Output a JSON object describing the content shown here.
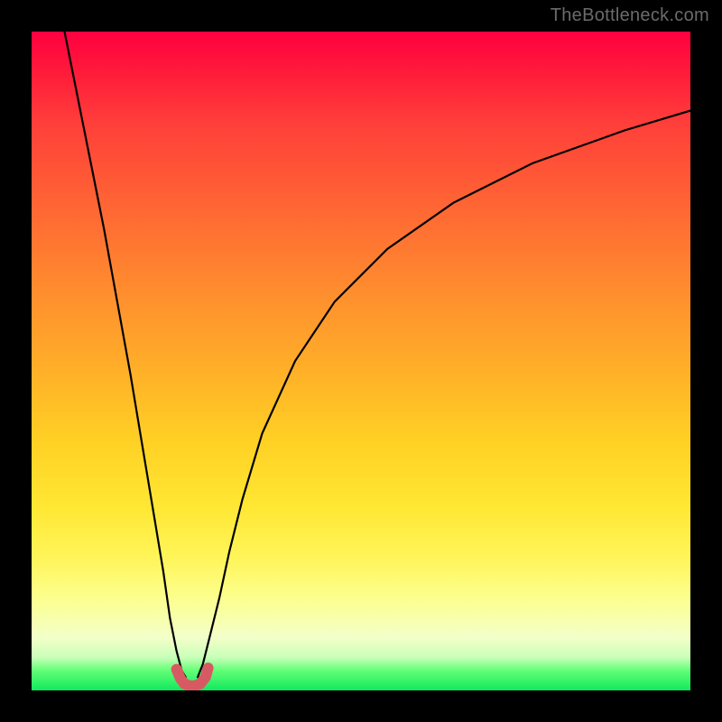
{
  "watermark": "TheBottleneck.com",
  "chart_data": {
    "type": "line",
    "title": "",
    "xlabel": "",
    "ylabel": "",
    "xlim": [
      0,
      100
    ],
    "ylim": [
      0,
      100
    ],
    "grid": false,
    "legend": false,
    "series": [
      {
        "name": "left-branch",
        "x": [
          5,
          7,
          9,
          11,
          13,
          15,
          17,
          18.5,
          20,
          21,
          22,
          22.8,
          23.4
        ],
        "y": [
          100,
          90,
          80,
          70,
          59,
          48,
          36,
          27,
          18,
          11,
          6,
          3,
          2
        ]
      },
      {
        "name": "right-branch",
        "x": [
          25.2,
          26,
          27,
          28.5,
          30,
          32,
          35,
          40,
          46,
          54,
          64,
          76,
          90,
          100
        ],
        "y": [
          2,
          4,
          8,
          14,
          21,
          29,
          39,
          50,
          59,
          67,
          74,
          80,
          85,
          88
        ]
      },
      {
        "name": "valley-marker",
        "x": [
          22.0,
          22.6,
          23.2,
          24.0,
          24.8,
          25.6,
          26.4,
          26.8
        ],
        "y": [
          3.2,
          1.8,
          1.0,
          0.7,
          0.7,
          1.0,
          2.0,
          3.4
        ]
      }
    ],
    "annotations": []
  }
}
